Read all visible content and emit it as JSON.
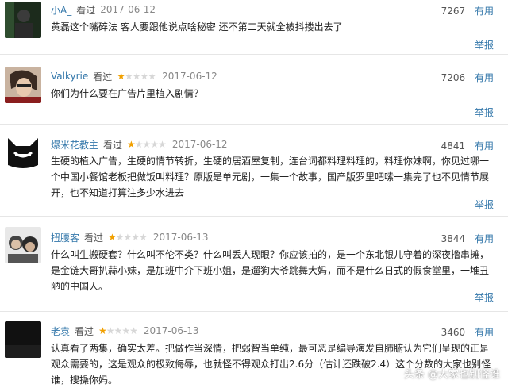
{
  "comments": [
    {
      "user": "小A_",
      "watched": "看过",
      "rating_stars": 0,
      "date": "2017-06-12",
      "votes": "7267",
      "useful_label": "有用",
      "text": "黄磊这个嘴碎法 客人要跟他说点啥秘密 还不第二天就全被抖搂出去了",
      "report_label": "举报"
    },
    {
      "user": "Valkyrie",
      "watched": "看过",
      "rating_stars": 1,
      "date": "2017-06-12",
      "votes": "7206",
      "useful_label": "有用",
      "text": "你们为什么要在广告片里植入剧情？",
      "report_label": "举报"
    },
    {
      "user": "爆米花教主",
      "watched": "看过",
      "rating_stars": 1,
      "date": "2017-06-12",
      "votes": "4841",
      "useful_label": "有用",
      "text": "生硬的植入广告，生硬的情节转折，生硬的居酒屋复制，连台词都料理料理的，料理你妹啊，你见过哪一个中国小餐馆老板把做饭叫料理？原版是单元剧，一集一个故事，国产版罗里吧嗦一集完了也不见情节展开，也不知道打算注多少水进去",
      "report_label": "举报"
    },
    {
      "user": "扭腰客",
      "watched": "看过",
      "rating_stars": 1,
      "date": "2017-06-13",
      "votes": "3844",
      "useful_label": "有用",
      "text": "什么叫生搬硬套？什么叫不伦不类？什么叫丢人现眼？你应该拍的，是一个东北银儿守着的深夜撸串摊，是金链大哥扒蒜小妹，是加班中介下班小姐，是遛狗大爷跳舞大妈，而不是什么日式的假食堂里，一堆丑陋的中国人。",
      "report_label": "举报"
    },
    {
      "user": "老袁",
      "watched": "看过",
      "rating_stars": 1,
      "date": "2017-06-13",
      "votes": "3460",
      "useful_label": "有用",
      "text": "认真看了两集，确实太差。把做作当深情，把弱智当单纯，最可恶是编导演发自肺腑认为它们呈现的正是观众需要的，这是观众的极致侮辱，也就怪不得观众打出2.6分（估计还跌破2.4）这个分数的大家也别怪谁，搜操你妈。",
      "report_label": ""
    }
  ],
  "watermark": "头条 @大家也别怪谁"
}
